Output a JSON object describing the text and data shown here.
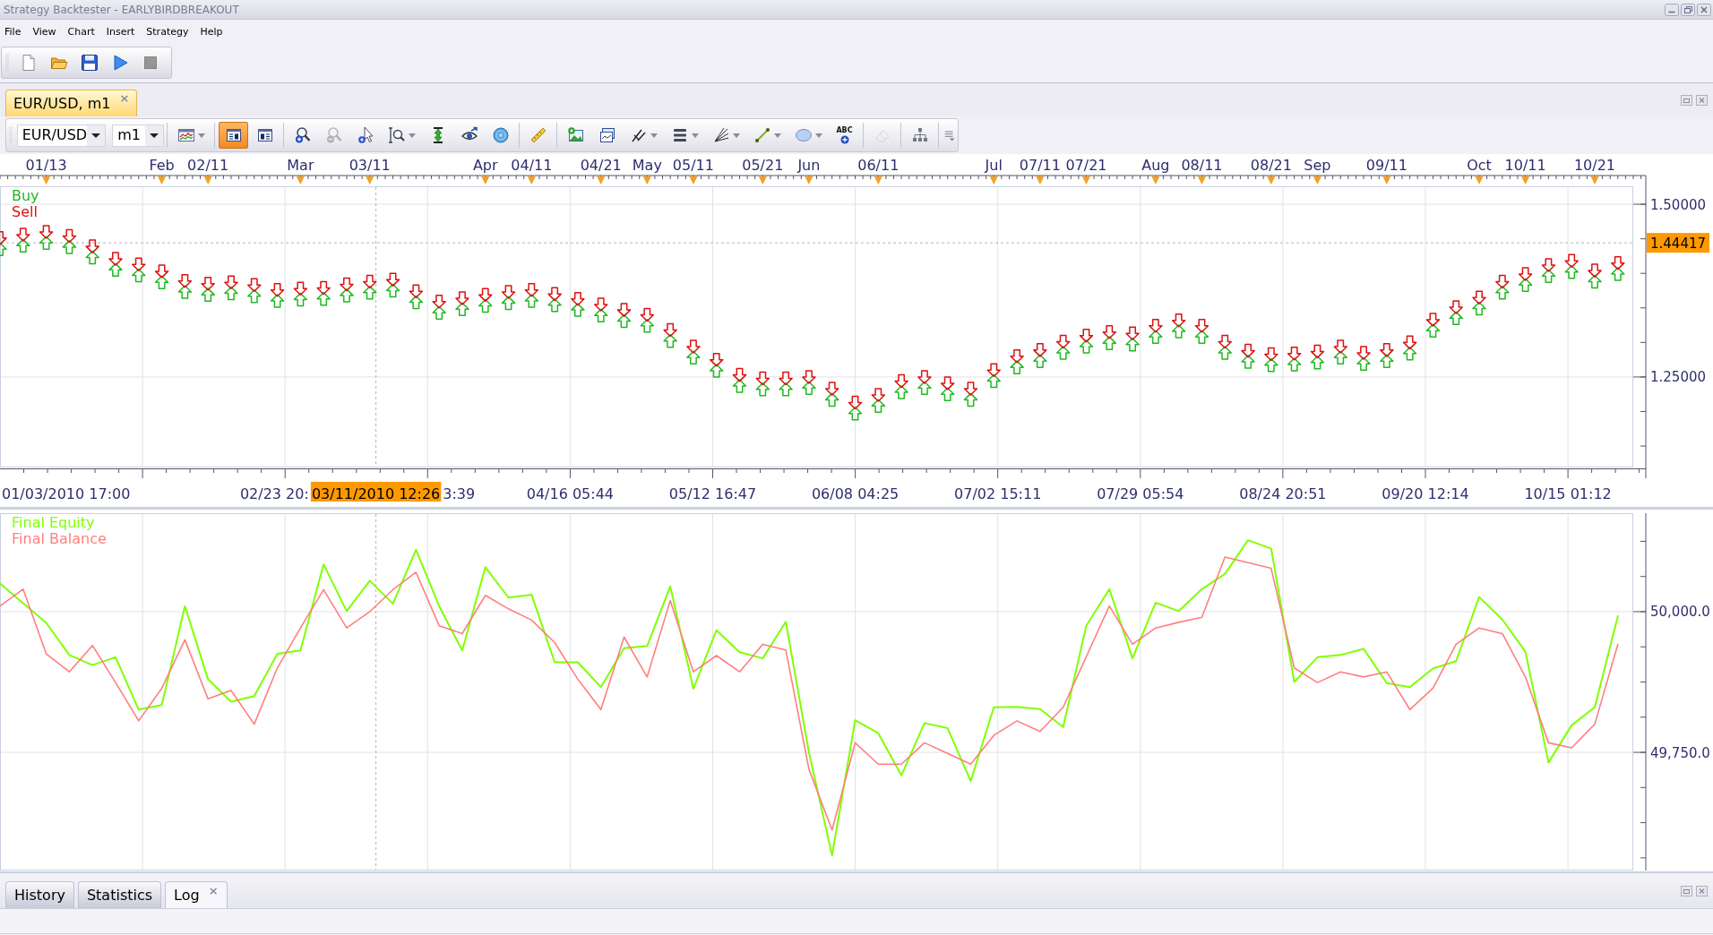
{
  "window": {
    "title": "Strategy Backtester - EARLYBIRDBREAKOUT"
  },
  "menu": [
    "File",
    "View",
    "Chart",
    "Insert",
    "Strategy",
    "Help"
  ],
  "main_toolbar": [
    {
      "disabled": false
    },
    {
      "disabled": false
    },
    {
      "disabled": false
    },
    {
      "disabled": false
    },
    {
      "disabled": true
    }
  ],
  "chart_tab": {
    "label": "EUR/USD, m1",
    "close": "×",
    "selected": true
  },
  "chart_toolbar": {
    "instrument": "EUR/USD",
    "period": "m1",
    "buttons": [
      {
        "selected": false,
        "disabled": false,
        "dropdown": true
      },
      {
        "selected": true,
        "disabled": false,
        "dropdown": false
      },
      {
        "selected": false,
        "disabled": false,
        "dropdown": false
      },
      {
        "selected": false,
        "disabled": false,
        "dropdown": false
      },
      {
        "selected": false,
        "disabled": true,
        "dropdown": false
      },
      {
        "selected": false,
        "disabled": false,
        "dropdown": false
      },
      {
        "selected": false,
        "disabled": false,
        "dropdown": true
      },
      {
        "selected": false,
        "disabled": false,
        "dropdown": false
      },
      {
        "selected": false,
        "disabled": false,
        "dropdown": false
      },
      {
        "selected": false,
        "disabled": false,
        "dropdown": false
      },
      {
        "selected": false,
        "disabled": false,
        "dropdown": false
      },
      {
        "selected": false,
        "disabled": false,
        "dropdown": false
      },
      {
        "selected": false,
        "disabled": false,
        "dropdown": false
      },
      {
        "selected": false,
        "disabled": false,
        "dropdown": true
      },
      {
        "selected": false,
        "disabled": false,
        "dropdown": true
      },
      {
        "selected": false,
        "disabled": false,
        "dropdown": true
      },
      {
        "selected": false,
        "disabled": false,
        "dropdown": true
      },
      {
        "selected": false,
        "disabled": false,
        "dropdown": true
      },
      {
        "selected": false,
        "disabled": false,
        "dropdown": false,
        "glyph": "ABC"
      },
      {
        "selected": false,
        "disabled": true,
        "dropdown": false
      },
      {
        "selected": false,
        "disabled": false,
        "dropdown": false
      },
      {
        "selected": false,
        "disabled": false,
        "dropdown": false
      }
    ]
  },
  "price_chart": {
    "chart_data": {
      "type": "scatter",
      "grid": true,
      "categories": [
        null,
        null,
        "01/13",
        null,
        null,
        null,
        null,
        "Feb",
        null,
        "02/11",
        null,
        null,
        null,
        "Mar",
        null,
        null,
        "03/11",
        null,
        null,
        null,
        null,
        "Apr",
        null,
        "04/11",
        null,
        null,
        "04/21",
        null,
        "May",
        null,
        "05/11",
        null,
        null,
        "05/21",
        null,
        "Jun",
        null,
        null,
        "06/11",
        null,
        null,
        null,
        null,
        "Jul",
        null,
        "07/11",
        null,
        "07/21",
        null,
        null,
        "Aug",
        null,
        "08/11",
        null,
        null,
        "08/21",
        null,
        "Sep",
        null,
        null,
        "09/11",
        null,
        null,
        null,
        "Oct",
        null,
        "10/11",
        null,
        null,
        "10/21",
        null
      ],
      "ylim": [
        1.119,
        1.526
      ],
      "yticks": [
        {
          "value": 1.5,
          "label": "1.50000"
        },
        {
          "value": 1.25,
          "label": "1.25000"
        }
      ],
      "series": [
        {
          "name": "Buy",
          "color": "#22b822",
          "values": [
            1.435,
            1.44,
            1.444,
            1.438,
            1.423,
            1.405,
            1.397,
            1.387,
            1.373,
            1.369,
            1.371,
            1.367,
            1.36,
            1.362,
            1.363,
            1.368,
            1.372,
            1.375,
            1.358,
            1.343,
            1.348,
            1.353,
            1.357,
            1.36,
            1.354,
            1.347,
            1.339,
            1.331,
            1.324,
            1.302,
            1.278,
            1.259,
            1.237,
            1.232,
            1.232,
            1.234,
            1.217,
            1.197,
            1.208,
            1.228,
            1.234,
            1.225,
            1.217,
            1.244,
            1.264,
            1.273,
            1.285,
            1.294,
            1.299,
            1.297,
            1.308,
            1.316,
            1.308,
            1.285,
            1.272,
            1.267,
            1.268,
            1.271,
            1.278,
            1.269,
            1.273,
            1.284,
            1.317,
            1.335,
            1.349,
            1.372,
            1.383,
            1.396,
            1.402,
            1.388,
            1.399
          ]
        },
        {
          "name": "Sell",
          "color": "#dd1111",
          "values": [
            1.451,
            1.456,
            1.46,
            1.454,
            1.439,
            1.421,
            1.413,
            1.403,
            1.389,
            1.385,
            1.387,
            1.383,
            1.376,
            1.378,
            1.379,
            1.384,
            1.388,
            1.391,
            1.374,
            1.359,
            1.364,
            1.369,
            1.373,
            1.376,
            1.37,
            1.363,
            1.355,
            1.347,
            1.34,
            1.318,
            1.294,
            1.275,
            1.253,
            1.248,
            1.248,
            1.25,
            1.233,
            1.213,
            1.224,
            1.244,
            1.25,
            1.241,
            1.233,
            1.26,
            1.28,
            1.289,
            1.301,
            1.31,
            1.315,
            1.313,
            1.324,
            1.332,
            1.324,
            1.301,
            1.288,
            1.283,
            1.284,
            1.287,
            1.294,
            1.285,
            1.289,
            1.3,
            1.333,
            1.351,
            1.365,
            1.388,
            1.399,
            1.412,
            1.418,
            1.404,
            1.415
          ]
        }
      ],
      "ref_lines": [
        {
          "axis": "y",
          "value": 1.44417,
          "label": "1.44417"
        }
      ]
    },
    "time_axis": [
      "01/03/2010 17:00",
      "02/23 20:",
      "3:39",
      "04/16 05:44",
      "05/12 16:47",
      "06/08 04:25",
      "07/02 15:11",
      "07/29 05:54",
      "08/24 20:51",
      "09/20 12:14",
      "10/15 01:12"
    ],
    "crosshair_time": "03/11/2010 12:26"
  },
  "equity_chart": {
    "chart_data": {
      "type": "line",
      "grid": true,
      "categories": [
        null,
        null,
        null,
        null,
        null,
        null,
        null,
        null,
        null,
        null,
        null,
        null,
        null,
        null,
        null,
        null,
        null,
        null,
        null,
        null,
        null,
        null,
        null,
        null,
        null,
        null,
        null,
        null,
        null,
        null,
        null,
        null,
        null,
        null,
        null,
        null,
        null,
        null,
        null,
        null,
        null,
        null,
        null,
        null,
        null,
        null,
        null,
        null,
        null,
        null,
        null,
        null,
        null,
        null,
        null,
        null,
        null,
        null,
        null,
        null,
        null,
        null,
        null,
        null,
        null,
        null,
        null,
        null,
        null,
        null,
        null
      ],
      "ylim": [
        49540,
        50175
      ],
      "yticks": [
        {
          "value": 50000,
          "label": "50,000.0"
        },
        {
          "value": 49750,
          "label": "49,750.0"
        }
      ],
      "series": [
        {
          "name": "Final Equity",
          "color": "#80ff00",
          "values": [
            50050,
            50015,
            49980,
            49923,
            49905,
            49919,
            49826,
            49834,
            50010,
            49880,
            49840,
            49850,
            49925,
            49931,
            50084,
            50001,
            50055,
            50014,
            50110,
            50010,
            49931,
            50079,
            50025,
            50030,
            49910,
            49910,
            49866,
            49935,
            49939,
            50045,
            49863,
            49967,
            49928,
            49917,
            49982,
            49750,
            49567,
            49807,
            49784,
            49709,
            49802,
            49793,
            49699,
            49830,
            49831,
            49827,
            49795,
            49975,
            50040,
            49917,
            50016,
            50001,
            50040,
            50067,
            50127,
            50112,
            49875,
            49919,
            49923,
            49934,
            49873,
            49866,
            49899,
            49912,
            50026,
            49986,
            49929,
            49732,
            49798,
            49830,
            49992
          ]
        },
        {
          "name": "Final Balance",
          "color": "#ff7f7f",
          "values": [
            50010,
            50040,
            49925,
            49893,
            49940,
            49874,
            49806,
            49864,
            49950,
            49845,
            49860,
            49800,
            49900,
            49971,
            50039,
            49971,
            50000,
            50039,
            50070,
            49975,
            49961,
            50029,
            50005,
            49985,
            49945,
            49880,
            49826,
            49955,
            49884,
            50020,
            49893,
            49922,
            49893,
            49942,
            49932,
            49720,
            49612,
            49767,
            49729,
            49729,
            49767,
            49748,
            49729,
            49780,
            49806,
            49787,
            49830,
            49920,
            50010,
            49942,
            49971,
            49981,
            49990,
            50097,
            50087,
            50077,
            49900,
            49874,
            49893,
            49884,
            49893,
            49826,
            49864,
            49942,
            49971,
            49961,
            49884,
            49767,
            49758,
            49800,
            49942
          ]
        }
      ]
    }
  },
  "bottom_tabs": [
    {
      "label": "History",
      "selected": false
    },
    {
      "label": "Statistics",
      "selected": false
    },
    {
      "label": "Log",
      "selected": true,
      "close": "×"
    }
  ]
}
